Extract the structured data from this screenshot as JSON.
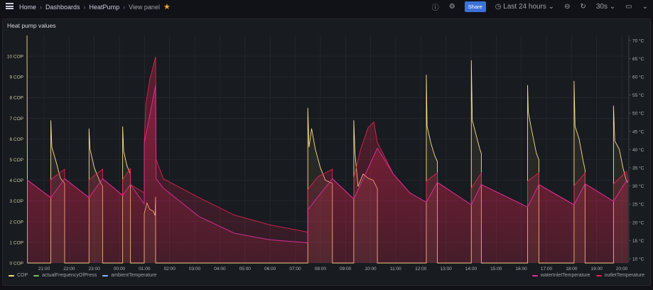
{
  "breadcrumb": {
    "items": [
      "Home",
      "Dashboards",
      "HeatPump"
    ],
    "current": "View panel"
  },
  "toolbar": {
    "share": "Share",
    "time_range": "Last 24 hours",
    "refresh": "30s"
  },
  "panel": {
    "title": "Heat pump values"
  },
  "legend": {
    "left": [
      {
        "label": "COP",
        "color": "#fade8a"
      },
      {
        "label": "actualFrequencyOfPress",
        "color": "#73bf69"
      },
      {
        "label": "ambientTemperature",
        "color": "#8ab8ff"
      }
    ],
    "right": [
      {
        "label": "waterInletTemperature",
        "color": "#e02fa0"
      },
      {
        "label": "outletTemperature",
        "color": "#e0224f"
      }
    ]
  },
  "chart_data": {
    "type": "line",
    "title": "Heat pump values",
    "x_unit": "hours since 20:00 (previous day)",
    "x_range": [
      0.32,
      24.25
    ],
    "x_ticks": [
      "21:00",
      "22:00",
      "23:00",
      "00:00",
      "01:00",
      "02:00",
      "03:00",
      "04:00",
      "05:00",
      "06:00",
      "07:00",
      "08:00",
      "09:00",
      "10:00",
      "11:00",
      "12:00",
      "13:00",
      "14:00",
      "15:00",
      "16:00",
      "17:00",
      "18:00",
      "19:00",
      "20:00"
    ],
    "y_left": {
      "ticks": [
        "0 COP",
        "1 COP",
        "2 COP",
        "3 COP",
        "4 COP",
        "5 COP",
        "6 COP",
        "7 COP",
        "8 COP",
        "9 COP",
        "10 COP"
      ],
      "range": [
        0,
        11
      ]
    },
    "y_right": {
      "ticks": [
        "10 °C",
        "15 °C",
        "20 °C",
        "25 °C",
        "30 °C",
        "35 °C",
        "40 °C",
        "45 °C",
        "50 °C",
        "55 °C",
        "60 °C",
        "65 °C",
        "70 °C"
      ],
      "range": [
        10,
        71
      ]
    },
    "series": [
      {
        "name": "COP",
        "axis": "left",
        "color": "#fade8a",
        "points": [
          [
            0.32,
            11
          ],
          [
            0.34,
            0
          ],
          [
            1.27,
            0
          ],
          [
            1.27,
            6.9
          ],
          [
            1.31,
            5.6
          ],
          [
            1.5,
            4.8
          ],
          [
            1.65,
            4.1
          ],
          [
            1.82,
            3.85
          ],
          [
            1.82,
            0
          ],
          [
            2.79,
            0
          ],
          [
            2.79,
            6.5
          ],
          [
            2.83,
            5.5
          ],
          [
            3.0,
            4.6
          ],
          [
            3.2,
            4.0
          ],
          [
            3.33,
            3.7
          ],
          [
            3.33,
            0
          ],
          [
            4.13,
            0
          ],
          [
            4.13,
            6.6
          ],
          [
            4.17,
            5.4
          ],
          [
            4.3,
            4.7
          ],
          [
            4.44,
            4.3
          ],
          [
            4.44,
            0
          ],
          [
            4.99,
            0
          ],
          [
            4.99,
            2.4
          ],
          [
            5.1,
            2.9
          ],
          [
            5.2,
            2.6
          ],
          [
            5.35,
            2.5
          ],
          [
            5.42,
            2.3
          ],
          [
            5.44,
            3.2
          ],
          [
            5.44,
            0
          ],
          [
            11.5,
            0
          ],
          [
            11.5,
            7.5
          ],
          [
            11.55,
            5.6
          ],
          [
            11.65,
            6.5
          ],
          [
            11.8,
            5.5
          ],
          [
            12.0,
            4.6
          ],
          [
            12.2,
            4.0
          ],
          [
            12.48,
            3.85
          ],
          [
            12.48,
            0
          ],
          [
            13.33,
            0
          ],
          [
            13.33,
            6.9
          ],
          [
            13.38,
            5.3
          ],
          [
            13.5,
            3.7
          ],
          [
            13.7,
            4.3
          ],
          [
            13.9,
            4.1
          ],
          [
            14.1,
            4.0
          ],
          [
            14.27,
            3.6
          ],
          [
            14.27,
            0
          ],
          [
            16.22,
            0
          ],
          [
            16.22,
            9.1
          ],
          [
            16.25,
            6.6
          ],
          [
            16.4,
            5.8
          ],
          [
            16.55,
            5.2
          ],
          [
            16.66,
            4.9
          ],
          [
            16.66,
            0
          ],
          [
            18.01,
            0
          ],
          [
            18.01,
            9.8
          ],
          [
            18.05,
            6.9
          ],
          [
            18.2,
            6.2
          ],
          [
            18.35,
            5.5
          ],
          [
            18.41,
            5.3
          ],
          [
            18.41,
            0
          ],
          [
            20.25,
            0
          ],
          [
            20.25,
            8.6
          ],
          [
            20.28,
            7.3
          ],
          [
            20.4,
            6.5
          ],
          [
            20.6,
            5.3
          ],
          [
            20.7,
            5.0
          ],
          [
            20.7,
            0
          ],
          [
            22.1,
            0
          ],
          [
            22.1,
            8.8
          ],
          [
            22.14,
            6.6
          ],
          [
            22.3,
            6.0
          ],
          [
            22.45,
            5.0
          ],
          [
            22.54,
            4.5
          ],
          [
            22.54,
            0
          ],
          [
            23.67,
            0
          ],
          [
            23.67,
            7.6
          ],
          [
            23.72,
            5.9
          ],
          [
            23.9,
            5.5
          ],
          [
            24.05,
            4.6
          ],
          [
            24.19,
            3.95
          ],
          [
            24.25,
            3.9
          ]
        ]
      },
      {
        "name": "outletTemperature",
        "axis": "right",
        "color": "#e0224f",
        "points": [
          [
            0.32,
            31.7
          ],
          [
            1.27,
            26.8
          ],
          [
            1.27,
            31.7
          ],
          [
            1.82,
            34.6
          ],
          [
            1.82,
            32.0
          ],
          [
            2.79,
            26.8
          ],
          [
            2.79,
            31.7
          ],
          [
            3.33,
            34.6
          ],
          [
            3.33,
            32.0
          ],
          [
            4.13,
            27.4
          ],
          [
            4.13,
            31.7
          ],
          [
            4.44,
            34.8
          ],
          [
            4.44,
            30.4
          ],
          [
            4.99,
            28.1
          ],
          [
            4.99,
            41.7
          ],
          [
            5.05,
            52.2
          ],
          [
            5.2,
            59
          ],
          [
            5.44,
            65.5
          ],
          [
            5.46,
            37.2
          ],
          [
            5.75,
            32
          ],
          [
            7.17,
            26.8
          ],
          [
            8.58,
            22.0
          ],
          [
            10.0,
            19.3
          ],
          [
            11.5,
            17.3
          ],
          [
            11.5,
            29.0
          ],
          [
            11.9,
            32.5
          ],
          [
            12.48,
            34.6
          ],
          [
            12.48,
            32.0
          ],
          [
            13.33,
            26.4
          ],
          [
            13.33,
            32.3
          ],
          [
            13.6,
            40
          ],
          [
            13.9,
            46
          ],
          [
            14.13,
            47.6
          ],
          [
            14.27,
            42
          ],
          [
            14.9,
            33.3
          ],
          [
            15.56,
            28.1
          ],
          [
            16.22,
            25.5
          ],
          [
            16.22,
            31.3
          ],
          [
            16.66,
            33.6
          ],
          [
            16.66,
            31.0
          ],
          [
            18.01,
            24.8
          ],
          [
            18.01,
            29.4
          ],
          [
            18.41,
            33.6
          ],
          [
            18.41,
            30.4
          ],
          [
            20.25,
            24.2
          ],
          [
            20.25,
            31.3
          ],
          [
            20.7,
            33.6
          ],
          [
            20.7,
            30.4
          ],
          [
            22.1,
            24.8
          ],
          [
            22.1,
            30.0
          ],
          [
            22.54,
            33.6
          ],
          [
            22.54,
            30.6
          ],
          [
            23.67,
            25.8
          ],
          [
            23.67,
            30.5
          ],
          [
            24.19,
            34.0
          ],
          [
            24.25,
            31.5
          ]
        ]
      },
      {
        "name": "waterInletTemperature",
        "axis": "right",
        "color": "#e02fa0",
        "points": [
          [
            0.32,
            31.7
          ],
          [
            1.27,
            26.8
          ],
          [
            1.82,
            32.0
          ],
          [
            2.79,
            26.8
          ],
          [
            3.33,
            32.0
          ],
          [
            4.13,
            27.4
          ],
          [
            4.44,
            30.4
          ],
          [
            4.99,
            25.1
          ],
          [
            4.99,
            41.7
          ],
          [
            5.44,
            57.7
          ],
          [
            5.46,
            32.0
          ],
          [
            5.75,
            29.4
          ],
          [
            7.17,
            21.6
          ],
          [
            8.58,
            17.0
          ],
          [
            10.0,
            15.2
          ],
          [
            11.5,
            14.4
          ],
          [
            11.5,
            23.5
          ],
          [
            12.48,
            32.0
          ],
          [
            13.33,
            26.4
          ],
          [
            14.27,
            40.4
          ],
          [
            14.9,
            33.3
          ],
          [
            15.56,
            28.1
          ],
          [
            16.22,
            25.5
          ],
          [
            16.66,
            31.0
          ],
          [
            18.01,
            24.8
          ],
          [
            18.41,
            30.4
          ],
          [
            20.25,
            24.2
          ],
          [
            20.7,
            30.4
          ],
          [
            22.1,
            24.8
          ],
          [
            22.54,
            30.6
          ],
          [
            23.67,
            25.8
          ],
          [
            24.19,
            31.5
          ],
          [
            24.25,
            31.2
          ]
        ]
      }
    ]
  }
}
